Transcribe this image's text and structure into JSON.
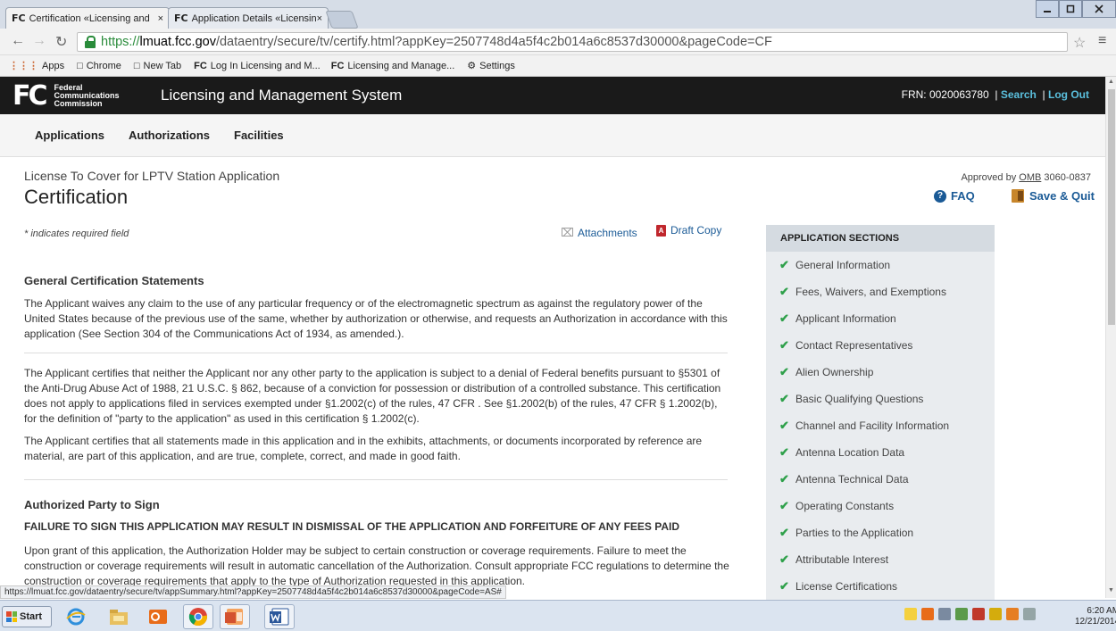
{
  "browser": {
    "tabs": [
      {
        "label": "Certification «Licensing and",
        "active": true
      },
      {
        "label": "Application Details «Licensin",
        "active": false
      }
    ],
    "tab_icon_text": "FC",
    "close_glyph": "×",
    "url_scheme": "https://",
    "url_host": "lmuat.fcc.gov",
    "url_path": "/dataentry/secure/tv/certify.html?appKey=2507748d4a5f4c2b014a6c8537d30000&pageCode=CF",
    "bookmarks": [
      {
        "label": "Apps",
        "icon": "apps-grid-icon"
      },
      {
        "label": "Chrome",
        "icon": "page-icon"
      },
      {
        "label": "New Tab",
        "icon": "page-icon"
      },
      {
        "label": "Log In Licensing and M...",
        "icon": "fcc-icon"
      },
      {
        "label": "Licensing and Manage...",
        "icon": "fcc-icon"
      },
      {
        "label": "Settings",
        "icon": "gear-icon"
      }
    ],
    "status_url": "https://lmuat.fcc.gov/dataentry/secure/tv/appSummary.html?appKey=2507748d4a5f4c2b014a6c8537d30000&pageCode=AS#"
  },
  "header": {
    "logo_letters": "FC",
    "logo_words": [
      "Federal",
      "Communications",
      "Commission"
    ],
    "system_title": "Licensing and Management System",
    "frn": "FRN: 0020063780",
    "search": "Search",
    "logout": "Log Out"
  },
  "nav": [
    "Applications",
    "Authorizations",
    "Facilities"
  ],
  "page": {
    "app_type": "License To Cover for LPTV Station Application",
    "title": "Certification",
    "omb_prefix": "Approved by ",
    "omb_link": "OMB",
    "omb_number": " 3060-0837",
    "faq": "FAQ",
    "save_quit": "Save & Quit",
    "required_note": "* indicates required field",
    "attachments": "Attachments",
    "draft_copy": "Draft Copy"
  },
  "content": {
    "general_heading": "General Certification Statements",
    "para1": "The Applicant waives any claim to the use of any particular frequency or of the electromagnetic spectrum as against the regulatory power of the United States because of the previous use of the same, whether by authorization or otherwise, and requests an Authorization in accordance with this application (See Section 304 of the Communications Act of 1934, as amended.).",
    "para2": "The Applicant certifies that neither the Applicant nor any other party to the application is subject to a denial of Federal benefits pursuant to §5301 of the Anti-Drug Abuse Act of 1988, 21 U.S.C. § 862, because of a conviction for possession or distribution of a controlled substance. This certification does not apply to applications filed in services exempted under §1.2002(c) of the rules, 47 CFR . See §1.2002(b) of the rules, 47 CFR § 1.2002(b), for the definition of \"party to the application\" as used in this certification § 1.2002(c).",
    "para3": "The Applicant certifies that all statements made in this application and in the exhibits, attachments, or documents incorporated by reference are material, are part of this application, and are true, complete, correct, and made in good faith.",
    "authorized_heading": "Authorized Party to Sign",
    "warning": "FAILURE TO SIGN THIS APPLICATION MAY RESULT IN DISMISSAL OF THE APPLICATION AND FORFEITURE OF ANY FEES PAID",
    "para4": "Upon grant of this application, the Authorization Holder may be subject to certain construction or coverage requirements. Failure to meet the construction or coverage requirements will result in automatic cancellation of the Authorization. Consult appropriate FCC regulations to determine the construction or coverage requirements that apply to the type of Authorization requested in this application."
  },
  "sidebar": {
    "heading": "APPLICATION SECTIONS",
    "check_glyph": "✔",
    "items": [
      "General Information",
      "Fees, Waivers, and Exemptions",
      "Applicant Information",
      "Contact Representatives",
      "Alien Ownership",
      "Basic Qualifying Questions",
      "Channel and Facility Information",
      "Antenna Location Data",
      "Antenna Technical Data",
      "Operating Constants",
      "Parties to the Application",
      "Attributable Interest",
      "License Certifications"
    ]
  },
  "taskbar": {
    "start": "Start",
    "time": "6:20 AM",
    "date": "12/21/2014"
  },
  "colors": {
    "header_bg": "#1a1a1a",
    "link": "#1a5a96",
    "header_link": "#5bc0de",
    "check": "#2ea04a",
    "sidebar_bg": "#e9ecef"
  }
}
